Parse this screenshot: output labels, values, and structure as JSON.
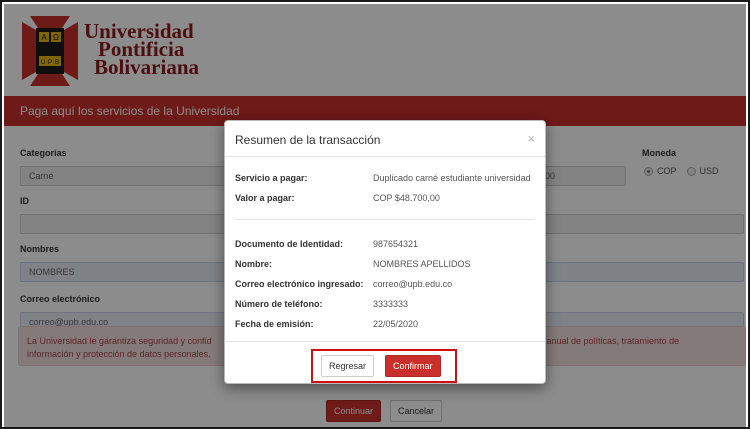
{
  "header": {
    "logo_letters": [
      "A",
      "Ω",
      "U",
      "P",
      "B"
    ],
    "logo_lines": [
      "Universidad",
      "Pontificia",
      "Bolivariana"
    ]
  },
  "hero": {
    "title": "Paga aquí los servicios de la Universidad"
  },
  "form": {
    "categorias": {
      "label": "Categorías",
      "value": "Carné"
    },
    "partial_value": "00",
    "moneda": {
      "label": "Moneda",
      "options": [
        "COP",
        "USD"
      ],
      "selected": "COP"
    },
    "id": {
      "label": "ID",
      "value": ""
    },
    "nombres": {
      "label": "Nombres",
      "value": "NOMBRES"
    },
    "correo": {
      "label": "Correo electrónico",
      "value": "correo@upb.edu.co"
    },
    "alert": {
      "left": "La Universidad le garantiza seguridad y confid información y protección de datos personales.",
      "right": "manual de políticas, tratamiento de"
    },
    "continuar": "Continuar",
    "cancelar": "Cancelar"
  },
  "modal": {
    "title": "Resumen de la transacción",
    "close": "×",
    "rows1": [
      {
        "k": "Servicio a pagar:",
        "v": "Duplicado carné estudiante universidad"
      },
      {
        "k": "Valor a pagar:",
        "v": "COP $48.700,00"
      }
    ],
    "rows2": [
      {
        "k": "Documento de Identidad:",
        "v": "987654321"
      },
      {
        "k": "Nombre:",
        "v": "NOMBRES APELLIDOS"
      },
      {
        "k": "Correo electrónico ingresado:",
        "v": "correo@upb.edu.co"
      },
      {
        "k": "Número de teléfono:",
        "v": "3333333"
      },
      {
        "k": "Fecha de emisión:",
        "v": "22/05/2020"
      }
    ],
    "regresar": "Regresar",
    "confirmar": "Confirmar"
  },
  "colors": {
    "brand_red": "#c9302c",
    "highlight": "#d01010"
  }
}
